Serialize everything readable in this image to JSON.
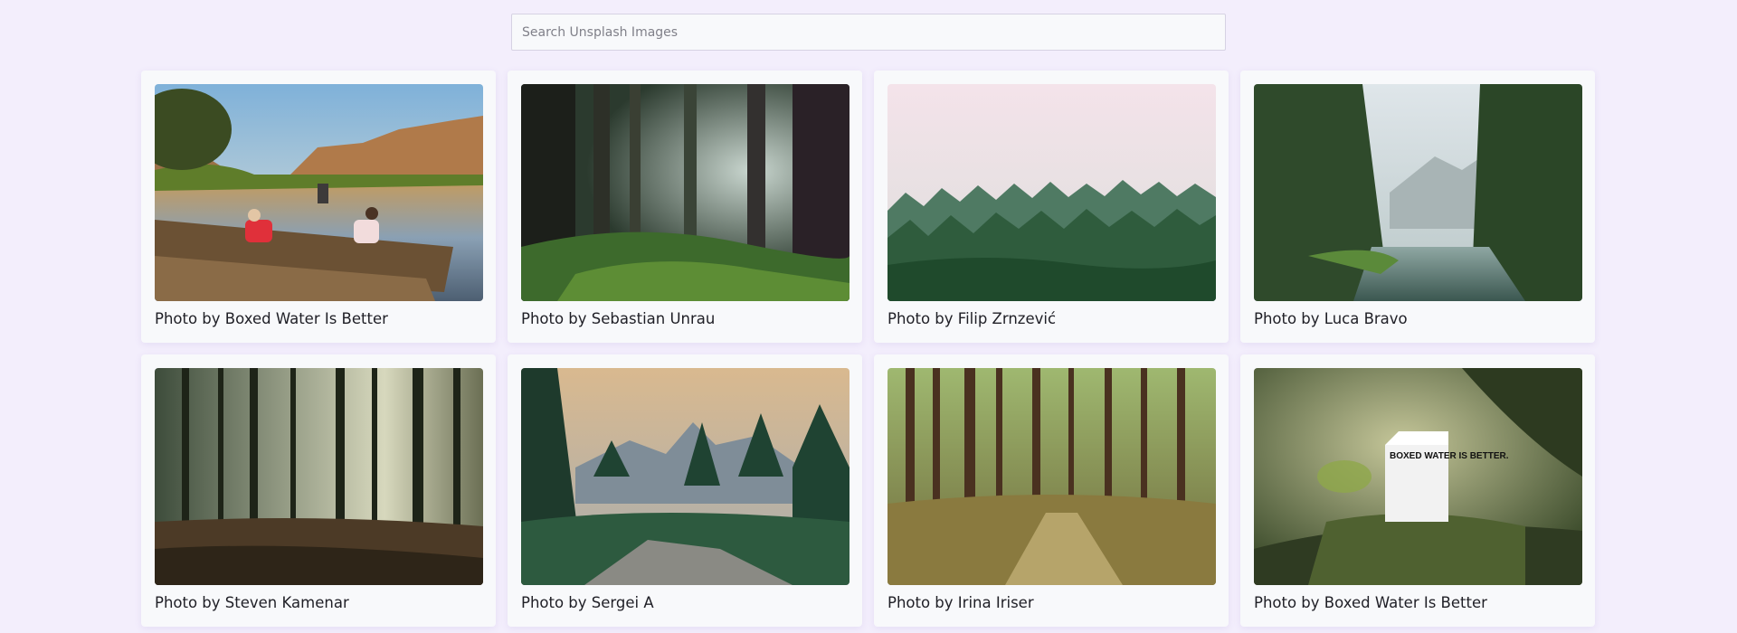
{
  "search": {
    "placeholder": "Search Unsplash Images",
    "value": ""
  },
  "photos": [
    {
      "caption": "Photo by Boxed Water Is Better",
      "scene": "lake-rocks-reflection-icon"
    },
    {
      "caption": "Photo by Sebastian Unrau",
      "scene": "dark-forest-icon"
    },
    {
      "caption": "Photo by Filip Zrnzević",
      "scene": "misty-forest-icon"
    },
    {
      "caption": "Photo by Luca Bravo",
      "scene": "river-forest-icon"
    },
    {
      "caption": "Photo by Steven Kamenar",
      "scene": "pine-forest-icon"
    },
    {
      "caption": "Photo by Sergei A",
      "scene": "mountain-sunset-icon"
    },
    {
      "caption": "Photo by Irina Iriser",
      "scene": "forest-path-icon"
    },
    {
      "caption": "Photo by Boxed Water Is Better",
      "scene": "water-carton-moss-icon"
    }
  ],
  "photo_overlay_text": {
    "carton_text": "BOXED WATER IS BETTER."
  }
}
